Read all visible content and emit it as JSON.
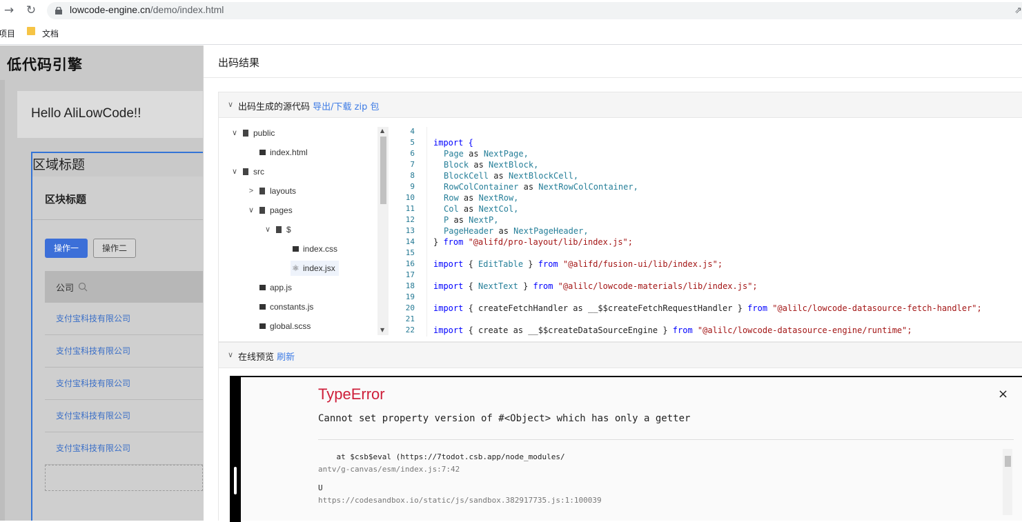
{
  "browser": {
    "url_host": "lowcode-engine.cn",
    "url_path": "/demo/index.html",
    "bookmarks": [
      "项目",
      "文档"
    ]
  },
  "left_app": {
    "logo": "低代码引擎",
    "hello": "Hello AliLowCode!!",
    "region_title": "区域标题",
    "block_title": "区块标题",
    "button_primary": "操作一",
    "button_secondary": "操作二",
    "table_header": "公司",
    "rows": [
      "支付宝科技有限公司",
      "支付宝科技有限公司",
      "支付宝科技有限公司",
      "支付宝科技有限公司",
      "支付宝科技有限公司"
    ]
  },
  "drawer": {
    "title": "出码结果",
    "source_panel": {
      "title": "出码生成的源代码",
      "link": "导出/下载 zip 包"
    },
    "preview_panel": {
      "title": "在线预览",
      "link": "刷新"
    },
    "tree": [
      "public",
      "index.html",
      "src",
      "layouts",
      "pages",
      "$",
      "index.css",
      "index.jsx",
      "app.js",
      "constants.js",
      "global.scss"
    ],
    "code_line_numbers": [
      "4",
      "5",
      "6",
      "7",
      "8",
      "9",
      "10",
      "11",
      "12",
      "13",
      "14",
      "15",
      "16",
      "17",
      "18",
      "19",
      "20",
      "21",
      "22"
    ],
    "code": {
      "l5": "import {",
      "l6": [
        "Page",
        "as",
        "NextPage,"
      ],
      "l7": [
        "Block",
        "as",
        "NextBlock,"
      ],
      "l8": [
        "BlockCell",
        "as",
        "NextBlockCell,"
      ],
      "l9": [
        "RowColContainer",
        "as",
        "NextRowColContainer,"
      ],
      "l10": [
        "Row",
        "as",
        "NextRow,"
      ],
      "l11": [
        "Col",
        "as",
        "NextCol,"
      ],
      "l12": [
        "P",
        "as",
        "NextP,"
      ],
      "l13": [
        "PageHeader",
        "as",
        "NextPageHeader,"
      ],
      "l14": [
        "} ",
        "from",
        " \"@alifd/pro-layout/lib/index.js\";"
      ],
      "l16": [
        "import",
        " { ",
        "EditTable",
        " } ",
        "from",
        " \"@alifd/fusion-ui/lib/index.js\";"
      ],
      "l18": [
        "import",
        " { ",
        "NextText",
        " } ",
        "from",
        " \"@alilc/lowcode-materials/lib/index.js\";"
      ],
      "l20": [
        "import",
        " { createFetchHandler as __$$createFetchRequestHandler } ",
        "from",
        " \"@alilc/lowcode-datasource-fetch-handler\";"
      ],
      "l22": [
        "import",
        " { create as __$$createDataSourceEngine } ",
        "from",
        " \"@alilc/lowcode-datasource-engine/runtime\";"
      ]
    },
    "error": {
      "title": "TypeError",
      "message": "Cannot set property version of #<Object> which has only a getter",
      "close": "×",
      "stack_1": "    at $csb$eval (https://7todot.csb.app/node_modules/",
      "stack_1_sub": "antv/g-canvas/esm/index.js:7:42",
      "stack_2": "U",
      "stack_2_sub": "https://codesandbox.io/static/js/sandbox.382917735.js:1:100039"
    }
  }
}
